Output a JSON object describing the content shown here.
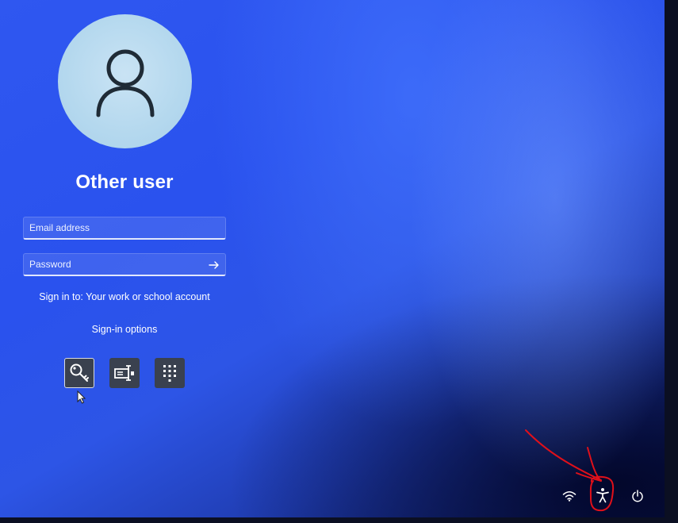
{
  "user": {
    "name": "Other user"
  },
  "form": {
    "email_placeholder": "Email address",
    "password_placeholder": "Password",
    "sign_in_to": "Sign in to: Your work or school account",
    "sign_in_options_label": "Sign-in options"
  },
  "sign_in_options": [
    {
      "icon": "key-icon",
      "selected": true
    },
    {
      "icon": "smart-card-icon",
      "selected": false
    },
    {
      "icon": "pin-keypad-icon",
      "selected": false
    }
  ],
  "tray": {
    "icons": [
      "wifi-icon",
      "accessibility-icon",
      "power-icon"
    ]
  },
  "colors": {
    "text": "#ffffff",
    "option_tile": "#3a414f",
    "annotation": "#e0101a"
  }
}
